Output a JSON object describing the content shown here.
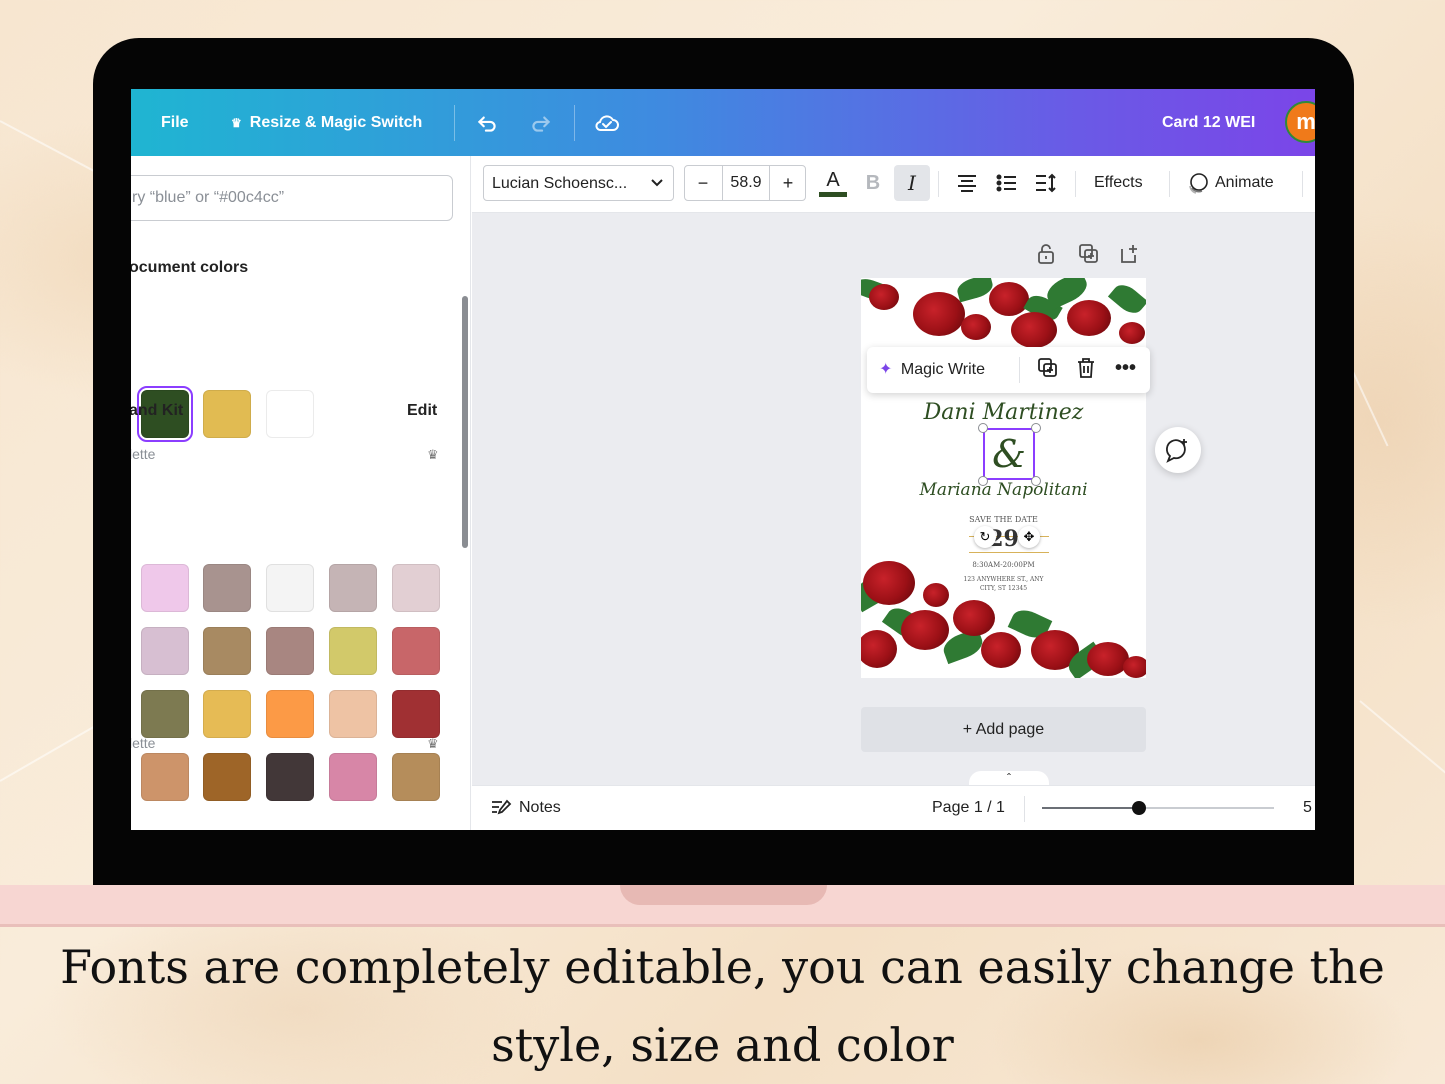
{
  "topbar": {
    "file_label": "File",
    "resize_label": "Resize & Magic Switch",
    "doc_title": "Card 12 WEI",
    "avatar_letter": "m",
    "icons": [
      "crown-icon",
      "undo-icon",
      "redo-icon",
      "cloud-save-icon"
    ]
  },
  "sidebar": {
    "search_placeholder": "ry “blue” or “#00c4cc”",
    "doc_colors_title": "ocument colors",
    "doc_colors": [
      "#2e4e22",
      "#e1bb52",
      "#ffffff"
    ],
    "brand_kit_title": "and Kit",
    "edit_label": "Edit",
    "palettes": [
      {
        "label": "lette",
        "colors": [
          "#efc8ea",
          "#a8938f",
          "#f4f4f4",
          "#c5b4b5",
          "#e2cfd3",
          "#d7bfd2",
          "#a88a62",
          "#a88681",
          "#d2c96a",
          "#c86669",
          "#7d7a51",
          "#e6bb55",
          "#fc9a46",
          "#eec3a4",
          "#a03033",
          "#cd946a",
          "#9e6528",
          "#423738",
          "#d786a7",
          "#b58d5b"
        ]
      },
      {
        "label": "lette",
        "colors": [
          "#463739",
          "#8eafe0",
          "#11045a",
          "#310b7d",
          "#efd8c7"
        ]
      }
    ]
  },
  "toolbar": {
    "font_name": "Lucian Schoensc...",
    "font_size": "58.9",
    "minus": "−",
    "plus": "+",
    "text_color_glyph": "A",
    "text_color": "#2e4e22",
    "bold_glyph": "B",
    "italic_glyph": "I",
    "effects_label": "Effects",
    "animate_label": "Animate"
  },
  "canvas": {
    "magic_write_label": "Magic Write",
    "add_page_label": "+ Add page",
    "card": {
      "name1": "Dani Martinez",
      "ampersand": "&",
      "name2": "Mariana Napolitani",
      "save_the_date": "SAVE THE DATE",
      "day": "29",
      "time": "8:30AM-20:00PM",
      "address1": "123 ANYWHERE ST., ANY",
      "address2": "CITY, ST 12345"
    }
  },
  "bottombar": {
    "notes_label": "Notes",
    "page_indicator": "Page 1 / 1",
    "zoom_text": "5",
    "zoom_fraction": 0.42
  },
  "caption": {
    "line1": "Fonts are completely editable, you can easily change the",
    "line2": "style, size and color"
  }
}
